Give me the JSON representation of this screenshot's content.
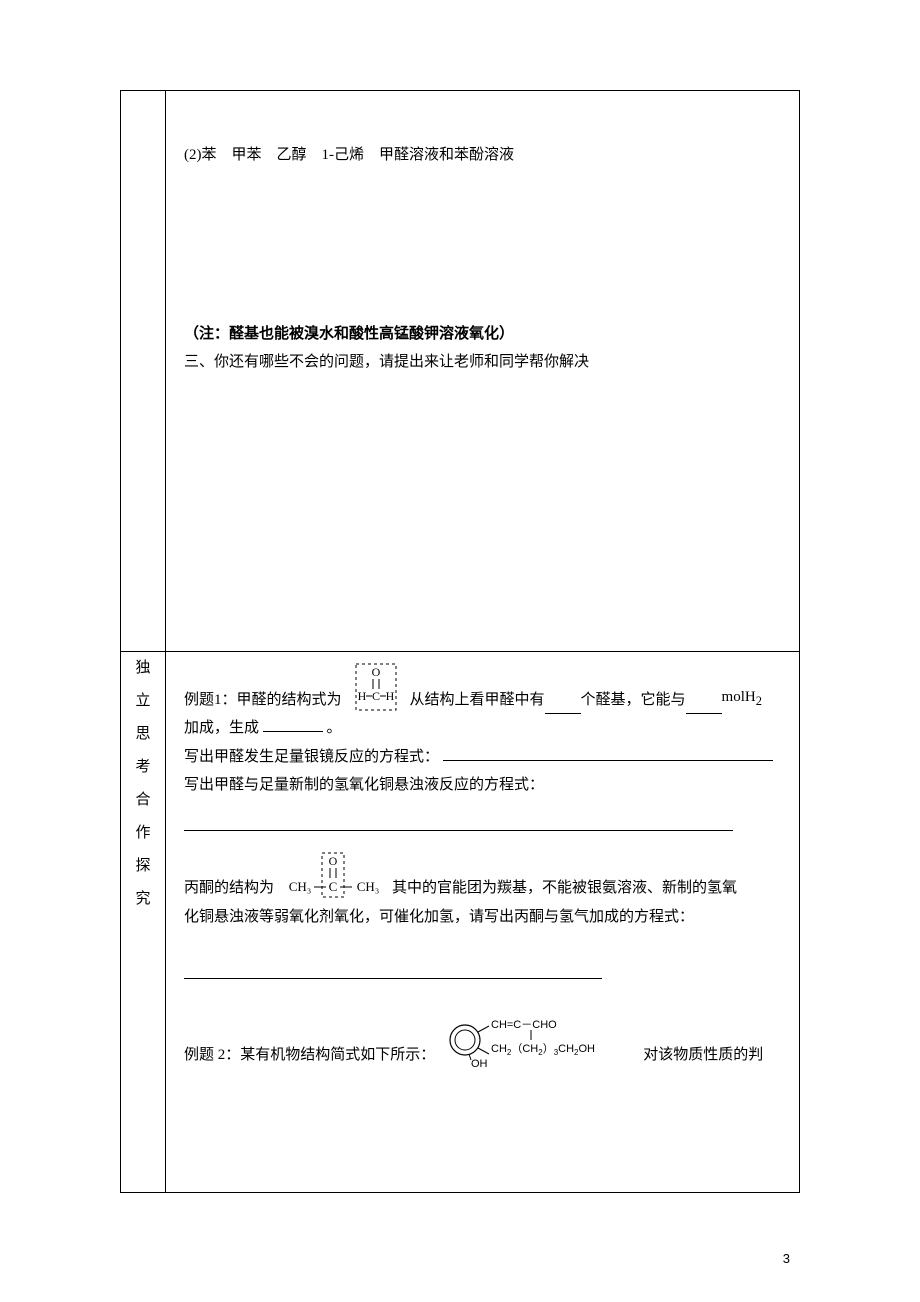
{
  "row1": {
    "line1": "(2)苯　甲苯　乙醇　1-己烯　甲醛溶液和苯酚溶液",
    "note": "（注：醛基也能被溴水和酸性高锰酸钾溶液氧化）",
    "line3": "三、你还有哪些不会的问题，请提出来让老师和同学帮你解决"
  },
  "row2": {
    "left_label": [
      "独",
      "立",
      "思",
      "考",
      "",
      "合",
      "作",
      "探",
      "究"
    ],
    "ex1_a": "例题1：甲醛的结构式为",
    "ex1_b": "从结构上看甲醛中有",
    "ex1_c": "个醛基，它能与",
    "ex1_d": "molH",
    "ex1_d_sub": "2",
    "ex1_e": "加成，生成",
    "ex1_f": "。",
    "ex1_g": "写出甲醛发生足量银镜反应的方程式：",
    "ex1_h": "写出甲醛与足量新制的氢氧化铜悬浊液反应的方程式：",
    "ketone_a": "丙酮的结构为",
    "ketone_b": "其中的官能团为羰基，不能被银氨溶液、新制的氢氧",
    "ketone_c": "化铜悬浊液等弱氧化剂氧化，可催化加氢，请写出丙酮与氢气加成的方程式：",
    "ex2_a": "例题 2：某有机物结构简式如下所示：",
    "ex2_b": "对该物质性质的判",
    "phenol_label_oh": "OH",
    "phenol_label_branch1": "CH=C－CHO",
    "phenol_label_branch2a": "CH",
    "phenol_label_branch2b": "（CH",
    "phenol_label_branch2c": "）",
    "phenol_label_branch2d": "CH",
    "phenol_label_branch2e": "OH"
  },
  "page_number": "3"
}
